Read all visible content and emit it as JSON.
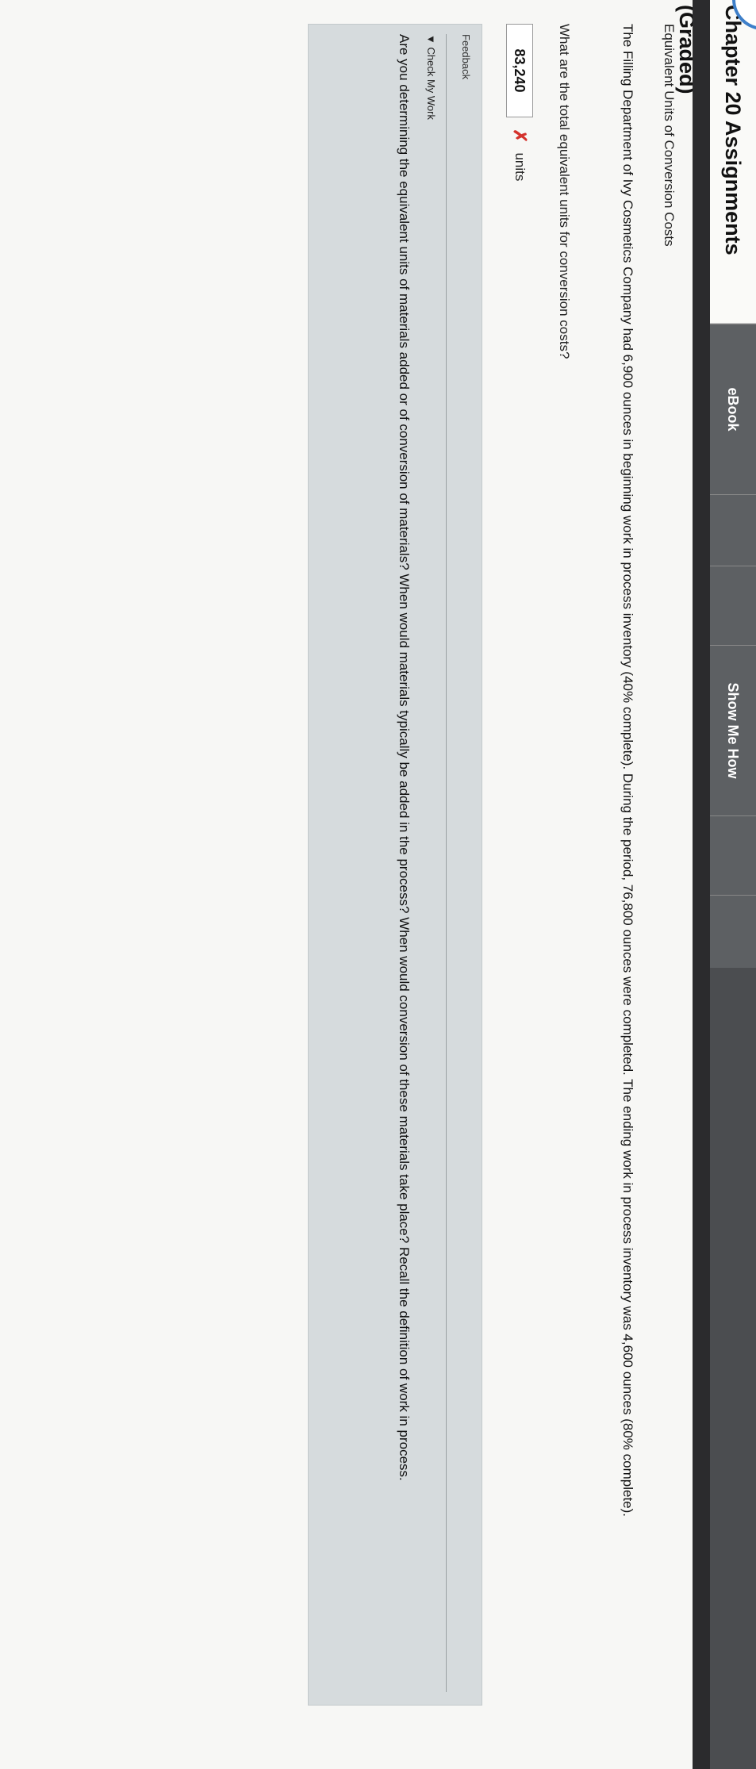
{
  "header": {
    "title": "Chapter 20 Assignments (Graded)",
    "tabs": [
      "eBook",
      "Show Me How"
    ]
  },
  "problem": {
    "subtitle": "Equivalent Units of Conversion Costs",
    "text": "The Filling Department of Ivy Cosmetics Company had 6,900 ounces in beginning work in process inventory (40% complete). During the period, 76,800 ounces were completed. The ending work in process inventory was 4,600 ounces (80% complete).",
    "question": "What are the total equivalent units for conversion costs?",
    "answer_value": "83,240",
    "units_label": "units"
  },
  "feedback": {
    "title": "Feedback",
    "toggle_label": "Check My Work",
    "text": "Are you determining the equivalent units of materials added or of conversion of materials? When would materials typically be added in the process? When would conversion of these materials take place? Recall the definition of work in process."
  }
}
